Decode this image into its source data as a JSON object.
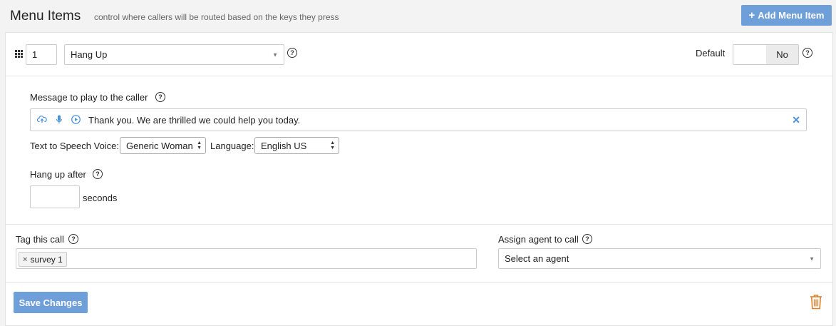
{
  "header": {
    "title": "Menu Items",
    "subtitle": "control where callers will be routed based on the keys they press",
    "add_button_icon": "+",
    "add_button_label": "Add Menu Item"
  },
  "menu_item": {
    "key_value": "1",
    "action_selected": "Hang Up",
    "default_label": "Default",
    "default_toggle_value": "No"
  },
  "message": {
    "label": "Message to play to the caller",
    "text": "Thank you. We are thrilled we could help you today.",
    "icons": [
      "cloud-upload-icon",
      "microphone-icon",
      "play-icon"
    ],
    "tts_voice_label": "Text to Speech Voice:",
    "tts_voice_selected": "Generic Woman",
    "language_label": "Language:",
    "language_selected": "English US"
  },
  "hangup": {
    "label": "Hang up after",
    "seconds_value": "",
    "unit": "seconds"
  },
  "tagging": {
    "label": "Tag this call",
    "tags": [
      "survey 1"
    ]
  },
  "assign": {
    "label": "Assign agent to call",
    "placeholder": "Select an agent"
  },
  "footer": {
    "save_label": "Save Changes"
  },
  "colors": {
    "primary_button": "#6f9fd8",
    "icon_blue": "#4a90d9",
    "trash": "#d9822b"
  }
}
